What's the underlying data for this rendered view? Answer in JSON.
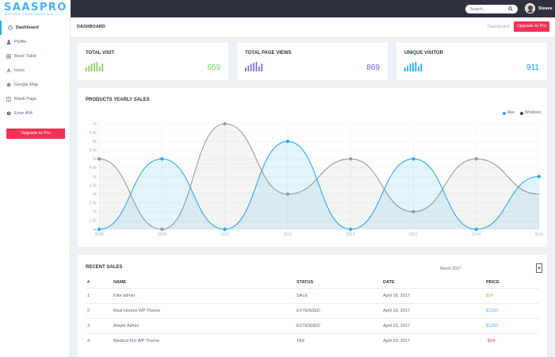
{
  "brand": {
    "title": "SAASPRO",
    "tagline": "EXPAND YOUR SAAS BIZ",
    "accent": "#41b3f9"
  },
  "topbar": {
    "search_placeholder": "Search...",
    "username": "Steave"
  },
  "sidebar": {
    "items": [
      {
        "label": "Dashboard",
        "icon": "clock-icon",
        "active": true
      },
      {
        "label": "Profile",
        "icon": "user-icon"
      },
      {
        "label": "Basic Table",
        "icon": "table-icon"
      },
      {
        "label": "Icons",
        "icon": "font-icon"
      },
      {
        "label": "Google Map",
        "icon": "globe-icon"
      },
      {
        "label": "Blank Page",
        "icon": "columns-icon"
      },
      {
        "label": "Error 404",
        "icon": "info-circle-icon"
      }
    ],
    "upgrade_label": "Upgrade to Pro"
  },
  "page": {
    "title": "DASHBOARD",
    "breadcrumb": "Dashboard",
    "upgrade_label": "Upgrade to Pro",
    "upgrade_color": "#f33155"
  },
  "stats": [
    {
      "title": "TOTAL VISIT",
      "value": "659",
      "color": "#7ace4c",
      "bars": [
        4,
        6,
        8,
        9,
        10,
        5,
        8
      ]
    },
    {
      "title": "TOTAL PAGE VIEWS",
      "value": "869",
      "color": "#7460ee",
      "bars": [
        4,
        6,
        8,
        9,
        10,
        5,
        8
      ]
    },
    {
      "title": "UNIQUE VISITOR",
      "value": "911",
      "color": "#11a0f8",
      "bars": [
        4,
        6,
        8,
        9,
        10,
        5,
        8
      ]
    }
  ],
  "chart": {
    "title": "PRODUCTS YEARLY SALES",
    "legend": [
      {
        "name": "Mac",
        "color": "#2cabe3"
      },
      {
        "name": "Windows",
        "color": "#3a3f4a"
      }
    ]
  },
  "chart_data": {
    "type": "area",
    "title": "PRODUCTS YEARLY SALES",
    "x": [
      "2008",
      "2009",
      "2010",
      "2011",
      "2012",
      "2013",
      "2014",
      "2015"
    ],
    "series": [
      {
        "name": "Mac",
        "values": [
          1,
          5,
          1,
          6,
          1,
          5,
          1,
          4
        ]
      },
      {
        "name": "Windows",
        "values": [
          5,
          1,
          7,
          3,
          5,
          2,
          5,
          3
        ]
      }
    ],
    "y_ticks": [
      "7k",
      "6.5k",
      "6k",
      "5.5k",
      "5k",
      "4.5k",
      "4k",
      "3.5k",
      "3k",
      "2.5k",
      "2k",
      "1.5k",
      "1k"
    ],
    "ylim": [
      1,
      7
    ],
    "grid": true,
    "legend_position": "top-right"
  },
  "sales": {
    "title": "RECENT SALES",
    "month": "March 2017",
    "headers": {
      "num": "#",
      "name": "NAME",
      "status": "STATUS",
      "date": "DATE",
      "price": "PRICE"
    },
    "rows": [
      {
        "num": "1",
        "name": "Elite admin",
        "status": "SALE",
        "date": "April 18, 2017",
        "price": "$24",
        "price_color": "#7ace4c"
      },
      {
        "num": "2",
        "name": "Real Homes WP Theme",
        "status": "EXTENDED",
        "date": "April 19, 2017",
        "price": "$1250",
        "price_color": "#41b3f9"
      },
      {
        "num": "3",
        "name": "Ample Admin",
        "status": "EXTENDED",
        "date": "April 19, 2017",
        "price": "$1250",
        "price_color": "#41b3f9"
      },
      {
        "num": "4",
        "name": "Medical Pro WP Theme",
        "status": "TAX",
        "date": "April 20, 2017",
        "price": "-$24",
        "price_color": "#f33155"
      }
    ]
  }
}
